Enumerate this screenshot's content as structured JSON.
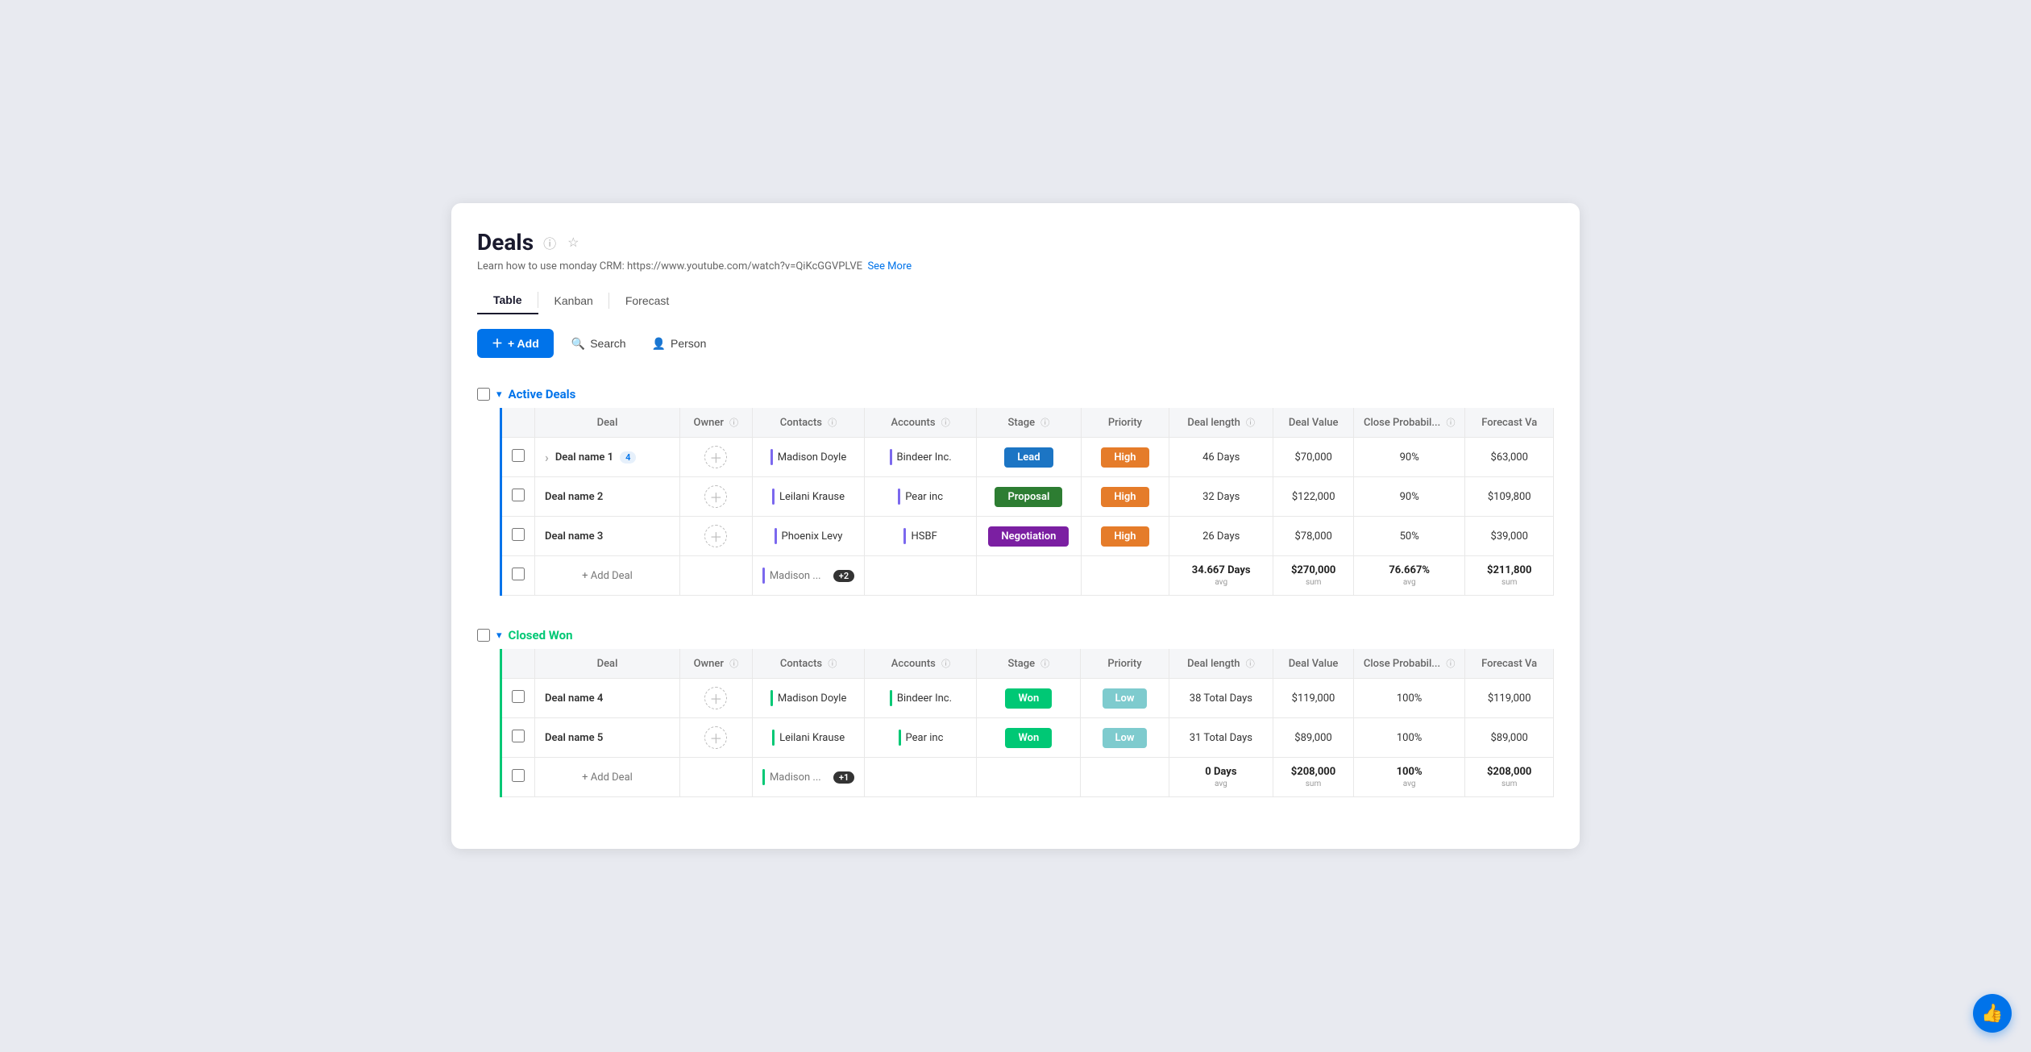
{
  "page": {
    "title": "Deals",
    "subtitle": "Learn how to use monday CRM: https://www.youtube.com/watch?v=QiKcGGVPLVE",
    "subtitle_link": "See More"
  },
  "tabs": [
    {
      "id": "table",
      "label": "Table",
      "active": true
    },
    {
      "id": "kanban",
      "label": "Kanban",
      "active": false
    },
    {
      "id": "forecast",
      "label": "Forecast",
      "active": false
    }
  ],
  "toolbar": {
    "add_label": "+ Add",
    "search_label": "Search",
    "person_label": "Person"
  },
  "active_deals": {
    "section_title": "Active Deals",
    "columns": [
      "Deal",
      "Owner",
      "Contacts",
      "Accounts",
      "Stage",
      "Priority",
      "Deal length",
      "Deal Value",
      "Close Probabil...",
      "Forecast Va"
    ],
    "rows": [
      {
        "id": 1,
        "deal_name": "Deal name 1",
        "deal_count": 4,
        "has_expand": true,
        "owner": "",
        "contacts": "Madison Doyle",
        "accounts": "Bindeer Inc.",
        "stage": "Lead",
        "stage_class": "stage-lead",
        "priority": "High",
        "priority_class": "priority-high",
        "deal_length": "46 Days",
        "deal_value": "$70,000",
        "close_prob": "90%",
        "forecast_val": "$63,000"
      },
      {
        "id": 2,
        "deal_name": "Deal name 2",
        "deal_count": null,
        "has_expand": false,
        "owner": "",
        "contacts": "Leilani Krause",
        "accounts": "Pear inc",
        "stage": "Proposal",
        "stage_class": "stage-proposal",
        "priority": "High",
        "priority_class": "priority-high",
        "deal_length": "32 Days",
        "deal_value": "$122,000",
        "close_prob": "90%",
        "forecast_val": "$109,800"
      },
      {
        "id": 3,
        "deal_name": "Deal name 3",
        "deal_count": null,
        "has_expand": false,
        "owner": "",
        "contacts": "Phoenix Levy",
        "accounts": "HSBF",
        "stage": "Negotiation",
        "stage_class": "stage-negotiation",
        "priority": "High",
        "priority_class": "priority-high",
        "deal_length": "26 Days",
        "deal_value": "$78,000",
        "close_prob": "50%",
        "forecast_val": "$39,000"
      }
    ],
    "summary": {
      "contacts_preview": "Madison ...",
      "contacts_extra": "+2",
      "deal_length_avg": "34.667 Days",
      "deal_length_label": "avg",
      "deal_value_sum": "$270,000",
      "deal_value_label": "sum",
      "close_prob_avg": "76.667%",
      "close_prob_label": "avg",
      "forecast_sum": "$211,800",
      "forecast_label": "sum"
    },
    "add_deal_label": "+ Add Deal"
  },
  "closed_won": {
    "section_title": "Closed Won",
    "columns": [
      "Deal",
      "Owner",
      "Contacts",
      "Accounts",
      "Stage",
      "Priority",
      "Deal length",
      "Deal Value",
      "Close Probabil...",
      "Forecast Va"
    ],
    "rows": [
      {
        "id": 4,
        "deal_name": "Deal name 4",
        "deal_count": null,
        "has_expand": false,
        "owner": "",
        "contacts": "Madison Doyle",
        "accounts": "Bindeer Inc.",
        "stage": "Won",
        "stage_class": "stage-won",
        "priority": "Low",
        "priority_class": "priority-low",
        "deal_length": "38 Total Days",
        "deal_value": "$119,000",
        "close_prob": "100%",
        "forecast_val": "$119,000"
      },
      {
        "id": 5,
        "deal_name": "Deal name 5",
        "deal_count": null,
        "has_expand": false,
        "owner": "",
        "contacts": "Leilani Krause",
        "accounts": "Pear inc",
        "stage": "Won",
        "stage_class": "stage-won",
        "priority": "Low",
        "priority_class": "priority-low",
        "deal_length": "31 Total Days",
        "deal_value": "$89,000",
        "close_prob": "100%",
        "forecast_val": "$89,000"
      }
    ],
    "summary": {
      "contacts_preview": "Madison ...",
      "contacts_extra": "+1",
      "deal_length_avg": "0 Days",
      "deal_length_label": "avg",
      "deal_value_sum": "$208,000",
      "deal_value_label": "sum",
      "close_prob_avg": "100%",
      "close_prob_label": "avg",
      "forecast_sum": "$208,000",
      "forecast_label": "sum"
    },
    "add_deal_label": "+ Add Deal"
  },
  "feedback_btn": "👍"
}
